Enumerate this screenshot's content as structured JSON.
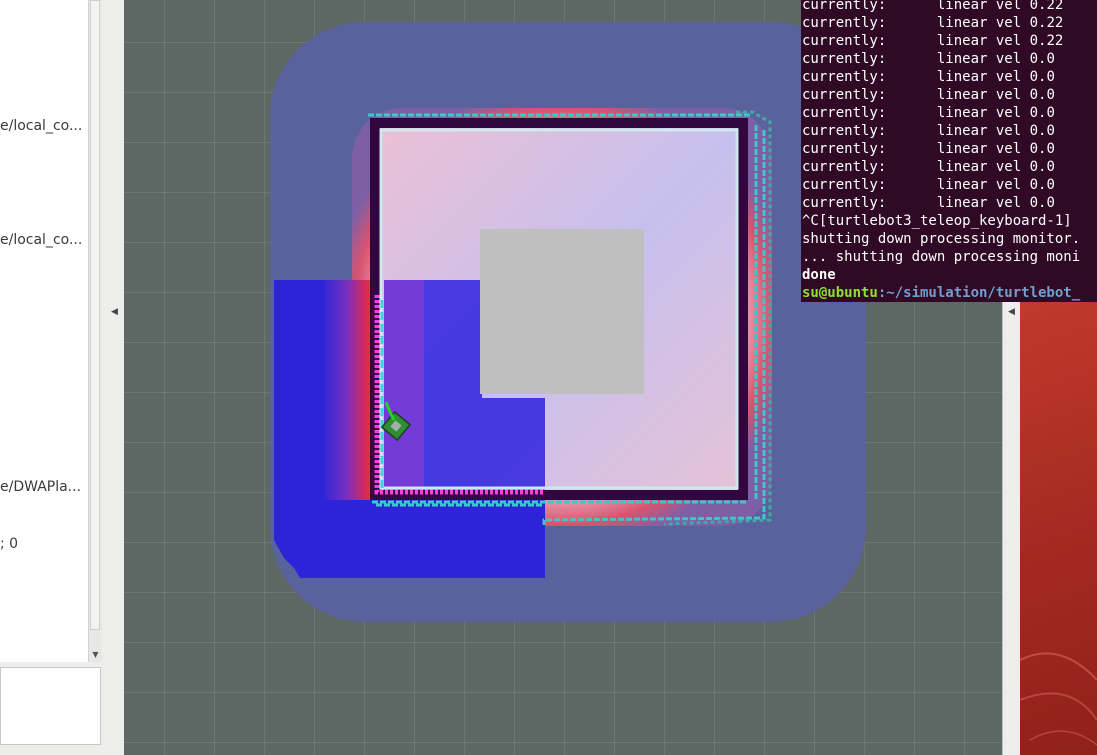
{
  "left_panel": {
    "items": [
      {
        "text": "e/local_co..."
      },
      {
        "text": "e/local_co..."
      },
      {
        "text": "e/DWAPla..."
      },
      {
        "text": "; 0"
      }
    ]
  },
  "terminal": {
    "velocity_lines": [
      {
        "prefix": "currently:",
        "text": "linear vel 0.22"
      },
      {
        "prefix": "currently:",
        "text": "linear vel 0.22"
      },
      {
        "prefix": "currently:",
        "text": "linear vel 0.22"
      },
      {
        "prefix": "currently:",
        "text": "linear vel 0.0"
      },
      {
        "prefix": "currently:",
        "text": "linear vel 0.0"
      },
      {
        "prefix": "currently:",
        "text": "linear vel 0.0"
      },
      {
        "prefix": "currently:",
        "text": "linear vel 0.0"
      },
      {
        "prefix": "currently:",
        "text": "linear vel 0.0"
      },
      {
        "prefix": "currently:",
        "text": "linear vel 0.0"
      },
      {
        "prefix": "currently:",
        "text": "linear vel 0.0"
      },
      {
        "prefix": "currently:",
        "text": "linear vel 0.0"
      },
      {
        "prefix": "currently:",
        "text": "linear vel 0.0"
      }
    ],
    "interrupt_line": "^C[turtlebot3_teleop_keyboard-1]",
    "shutdown_line": "shutting down processing monitor.",
    "shutdown_line2": "... shutting down processing moni",
    "done_line": "done",
    "prompt_user": "su@ubuntu",
    "prompt_path": ":~/simulation/turtlebot_"
  },
  "colors": {
    "viewport_bg": "#5d6763",
    "terminal_bg": "#300a24",
    "costmap_global": "#5a62a0",
    "costmap_local": "#2d23d8",
    "inflation": "#d63b5a",
    "free_space": "#c7c1ec",
    "unknown_block": "#bfbfbf",
    "wall": "#32063f",
    "laser": "#3ac8c8",
    "robot": "#3a9a3a",
    "desktop": "#b83328",
    "prompt_user": "#8ae234",
    "prompt_path": "#729fcf"
  },
  "icons": {
    "collapse_left": "triangle-left-icon",
    "collapse_right": "triangle-left-icon",
    "scroll_down": "triangle-down-icon"
  }
}
